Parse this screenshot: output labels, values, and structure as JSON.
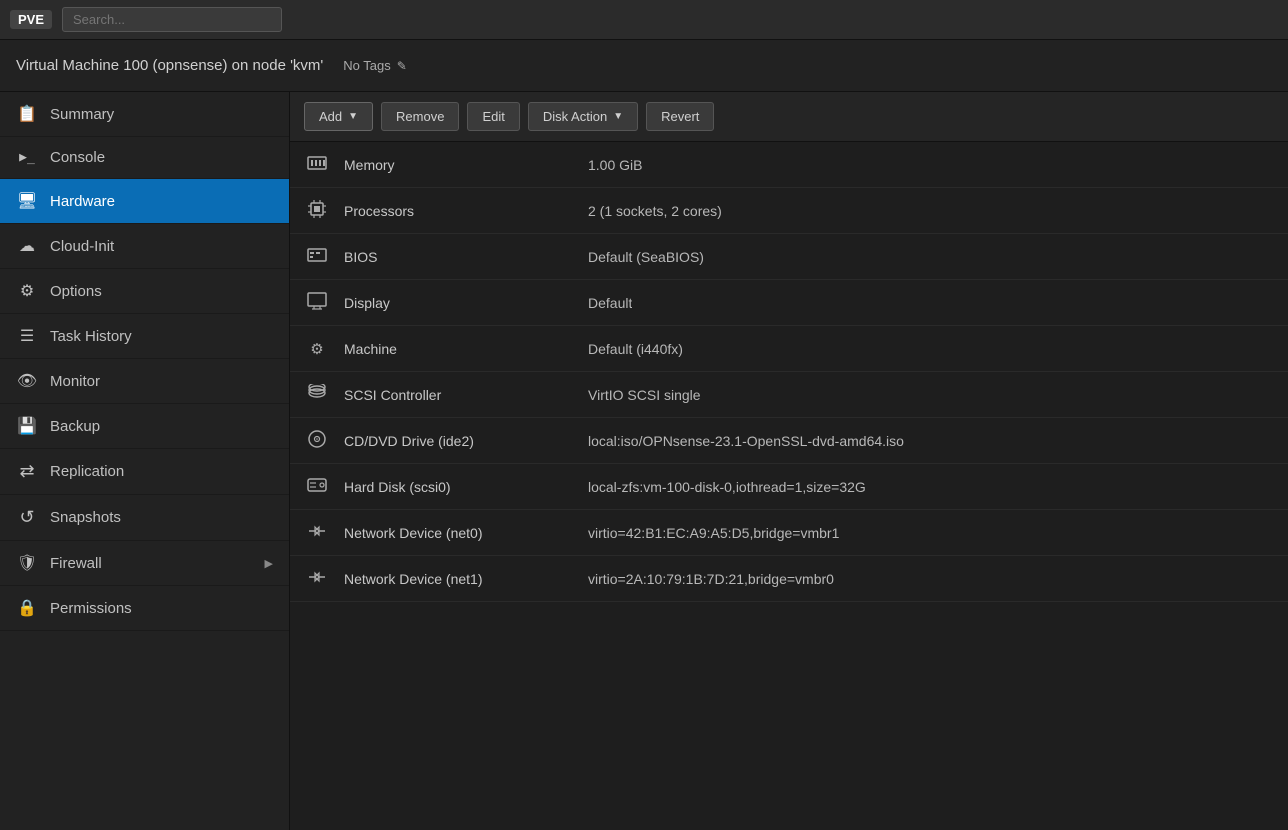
{
  "topbar": {
    "logo": "PVE",
    "search_placeholder": "Search..."
  },
  "vm": {
    "title": "Virtual Machine 100 (opnsense) on node 'kvm'",
    "tags_label": "No Tags",
    "edit_icon": "✎"
  },
  "toolbar": {
    "add_label": "Add",
    "remove_label": "Remove",
    "edit_label": "Edit",
    "disk_action_label": "Disk Action",
    "revert_label": "Revert"
  },
  "sidebar": {
    "items": [
      {
        "id": "summary",
        "label": "Summary",
        "icon": "📋",
        "active": false
      },
      {
        "id": "console",
        "label": "Console",
        "icon": ">_",
        "active": false
      },
      {
        "id": "hardware",
        "label": "Hardware",
        "icon": "🖥",
        "active": true
      },
      {
        "id": "cloud-init",
        "label": "Cloud-Init",
        "icon": "☁",
        "active": false
      },
      {
        "id": "options",
        "label": "Options",
        "icon": "⚙",
        "active": false
      },
      {
        "id": "task-history",
        "label": "Task History",
        "icon": "☰",
        "active": false
      },
      {
        "id": "monitor",
        "label": "Monitor",
        "icon": "👁",
        "active": false
      },
      {
        "id": "backup",
        "label": "Backup",
        "icon": "💾",
        "active": false
      },
      {
        "id": "replication",
        "label": "Replication",
        "icon": "↺",
        "active": false
      },
      {
        "id": "snapshots",
        "label": "Snapshots",
        "icon": "⟳",
        "active": false
      },
      {
        "id": "firewall",
        "label": "Firewall",
        "icon": "🛡",
        "active": false,
        "has_chevron": true
      },
      {
        "id": "permissions",
        "label": "Permissions",
        "icon": "🔒",
        "active": false
      }
    ]
  },
  "hardware": {
    "rows": [
      {
        "icon": "mem",
        "name": "Memory",
        "value": "1.00 GiB"
      },
      {
        "icon": "cpu",
        "name": "Processors",
        "value": "2 (1 sockets, 2 cores)"
      },
      {
        "icon": "bios",
        "name": "BIOS",
        "value": "Default (SeaBIOS)"
      },
      {
        "icon": "display",
        "name": "Display",
        "value": "Default"
      },
      {
        "icon": "machine",
        "name": "Machine",
        "value": "Default (i440fx)"
      },
      {
        "icon": "scsi",
        "name": "SCSI Controller",
        "value": "VirtIO SCSI single"
      },
      {
        "icon": "cdrom",
        "name": "CD/DVD Drive (ide2)",
        "value": "local:iso/OPNsense-23.1-OpenSSL-dvd-amd64.iso"
      },
      {
        "icon": "hdd",
        "name": "Hard Disk (scsi0)",
        "value": "local-zfs:vm-100-disk-0,iothread=1,size=32G"
      },
      {
        "icon": "net",
        "name": "Network Device (net0)",
        "value": "virtio=42:B1:EC:A9:A5:D5,bridge=vmbr1"
      },
      {
        "icon": "net",
        "name": "Network Device (net1)",
        "value": "virtio=2A:10:79:1B:7D:21,bridge=vmbr0"
      }
    ]
  }
}
